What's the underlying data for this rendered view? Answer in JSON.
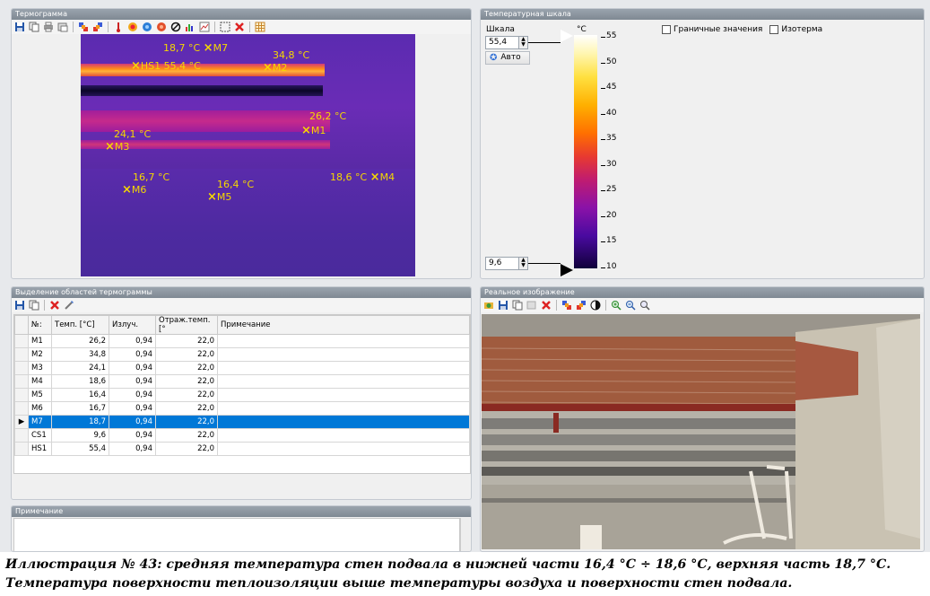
{
  "thermogram_panel": {
    "title": "Термограмма",
    "markers": [
      {
        "id": "M7",
        "label": "M7",
        "temp": "18,7 °C"
      },
      {
        "id": "M2",
        "label": "M2",
        "temp": "34,8 °C"
      },
      {
        "id": "HS1",
        "label": "HS1 55,4 °C"
      },
      {
        "id": "M1",
        "label": "M1",
        "temp": "26,2 °C"
      },
      {
        "id": "M3",
        "label": "M3",
        "temp": "24,1 °C"
      },
      {
        "id": "M6",
        "label": "M6",
        "temp": "16,7 °C"
      },
      {
        "id": "M5",
        "label": "M5",
        "temp": "16,4 °C"
      },
      {
        "id": "M4",
        "label": "M4",
        "temp": "18,6 °C"
      }
    ]
  },
  "scale_panel": {
    "title": "Температурная шкала",
    "scale_label": "Шкала",
    "max_value": "55,4",
    "min_value": "9,6",
    "auto_button": "Авто",
    "unit": "°C",
    "ticks": [
      "55",
      "50",
      "45",
      "40",
      "35",
      "30",
      "25",
      "20",
      "15",
      "10"
    ],
    "boundary_values": "Граничные значения",
    "isotherm": "Изотерма"
  },
  "regions_panel": {
    "title": "Выделение областей термограммы",
    "columns": [
      "№:",
      "Темп. [°C]",
      "Излуч.",
      "Отраж.темп. [°",
      "Примечание"
    ],
    "rows": [
      {
        "id": "M1",
        "temp": "26,2",
        "emis": "0,94",
        "refl": "22,0",
        "note": ""
      },
      {
        "id": "M2",
        "temp": "34,8",
        "emis": "0,94",
        "refl": "22,0",
        "note": ""
      },
      {
        "id": "M3",
        "temp": "24,1",
        "emis": "0,94",
        "refl": "22,0",
        "note": ""
      },
      {
        "id": "M4",
        "temp": "18,6",
        "emis": "0,94",
        "refl": "22,0",
        "note": ""
      },
      {
        "id": "M5",
        "temp": "16,4",
        "emis": "0,94",
        "refl": "22,0",
        "note": ""
      },
      {
        "id": "M6",
        "temp": "16,7",
        "emis": "0,94",
        "refl": "22,0",
        "note": ""
      },
      {
        "id": "M7",
        "temp": "18,7",
        "emis": "0,94",
        "refl": "22,0",
        "note": "",
        "selected": true
      },
      {
        "id": "CS1",
        "temp": "9,6",
        "emis": "0,94",
        "refl": "22,0",
        "note": ""
      },
      {
        "id": "HS1",
        "temp": "55,4",
        "emis": "0,94",
        "refl": "22,0",
        "note": ""
      }
    ]
  },
  "notes_panel": {
    "title": "Примечание"
  },
  "photo_panel": {
    "title": "Реальное изображение"
  },
  "caption": {
    "line1": "Иллюстрация № 43: средняя температура стен подвала в нижней части 16,4 °С ÷ 18,6 °С, верхняя часть 18,7 °С.",
    "line2": "Температура поверхности теплоизоляции выше температуры воздуха и поверхности стен подвала."
  },
  "colors": {
    "selection": "#0078d7",
    "marker": "#f5d800",
    "panel_title": "#8a939c"
  }
}
